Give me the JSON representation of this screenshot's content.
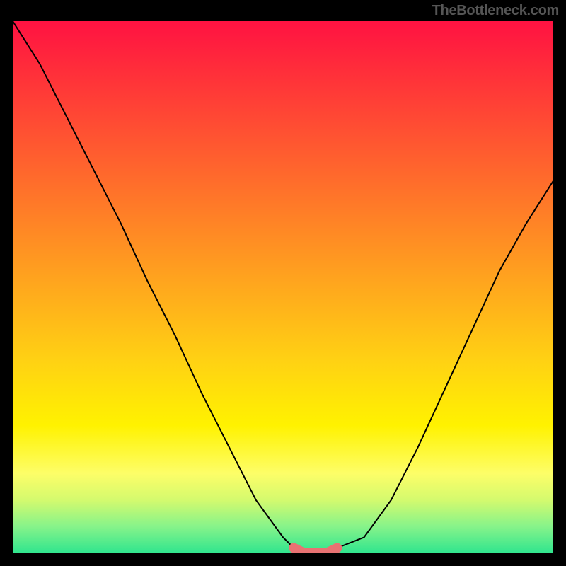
{
  "watermark": "TheBottleneck.com",
  "chart_data": {
    "type": "line",
    "title": "",
    "xlabel": "",
    "ylabel": "",
    "xlim": [
      0,
      100
    ],
    "ylim": [
      0,
      100
    ],
    "series": [
      {
        "name": "curve",
        "x": [
          0,
          5,
          10,
          15,
          20,
          25,
          30,
          35,
          40,
          45,
          50,
          52,
          55,
          58,
          60,
          65,
          70,
          75,
          80,
          85,
          90,
          95,
          100
        ],
        "y": [
          100,
          92,
          82,
          72,
          62,
          51,
          41,
          30,
          20,
          10,
          3,
          1,
          0,
          0,
          1,
          3,
          10,
          20,
          31,
          42,
          53,
          62,
          70
        ]
      },
      {
        "name": "highlight",
        "x": [
          52,
          54,
          56,
          58,
          60
        ],
        "y": [
          1,
          0,
          0,
          0,
          1
        ]
      }
    ]
  }
}
